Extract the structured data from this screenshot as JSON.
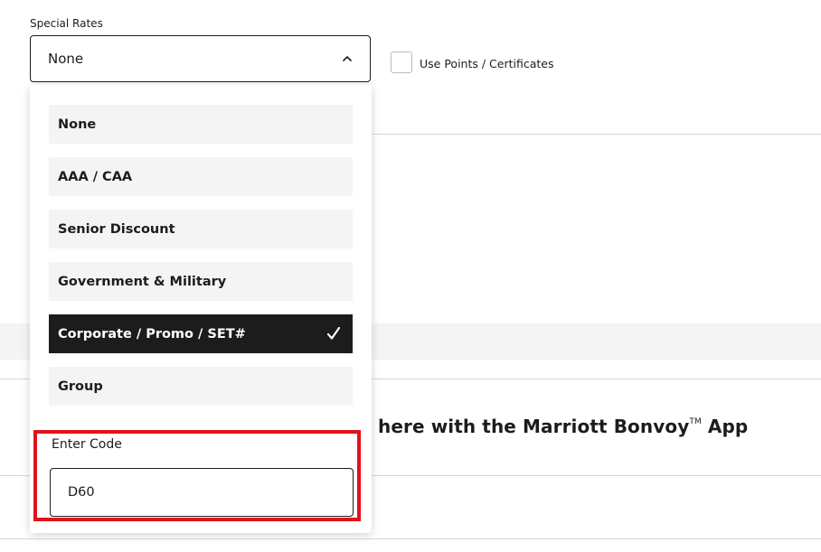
{
  "special_rates": {
    "label": "Special Rates",
    "selected_value": "None"
  },
  "points_checkbox": {
    "label": "Use Points / Certificates",
    "checked": false
  },
  "dropdown": {
    "options": [
      {
        "label": "None",
        "selected": false
      },
      {
        "label": "AAA / CAA",
        "selected": false
      },
      {
        "label": "Senior Discount",
        "selected": false
      },
      {
        "label": "Government & Military",
        "selected": false
      },
      {
        "label": "Corporate / Promo / SET#",
        "selected": true
      },
      {
        "label": "Group",
        "selected": false
      }
    ],
    "code": {
      "label": "Enter Code",
      "value": "D60"
    }
  },
  "background": {
    "promo_text": "here with the Marriott Bonvoy",
    "promo_tm": "TM",
    "promo_suffix": " App"
  },
  "icons": {
    "select_chevron": "chevron-up-icon",
    "selected_check": "checkmark-icon"
  },
  "colors": {
    "selected_bg": "#1c1c1c",
    "option_bg": "#f4f4f4",
    "highlight_border": "#e0121d"
  }
}
